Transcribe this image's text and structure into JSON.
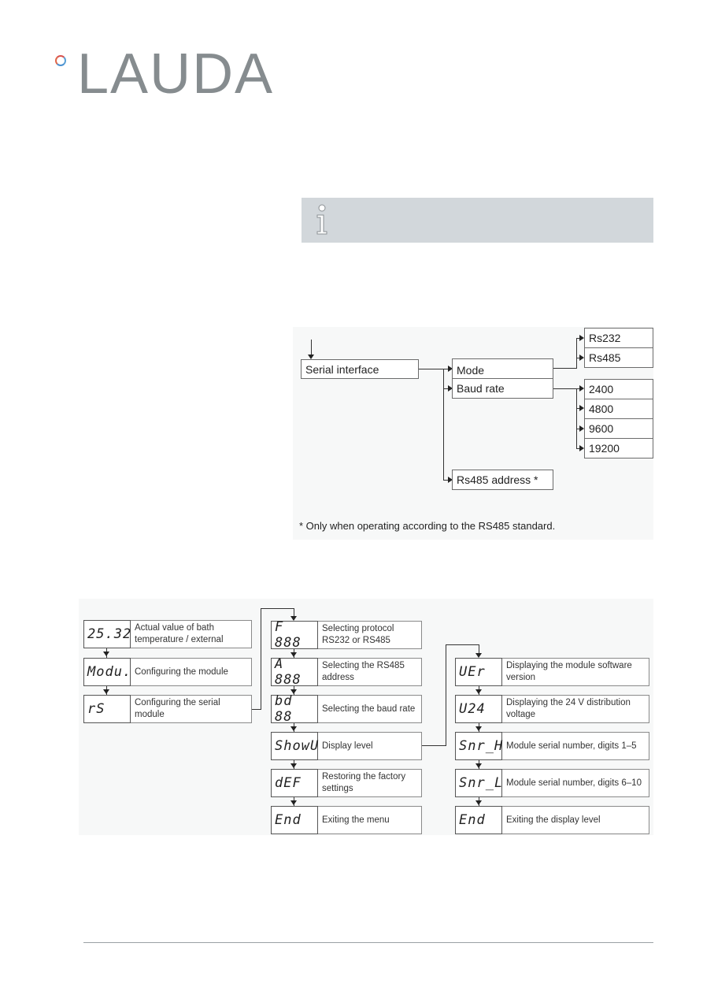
{
  "brand": {
    "logo_text": "LAUDA",
    "ring_colors": {
      "warm": "#d9534f",
      "cool": "#4a90d0"
    },
    "text_color": "#868c8f"
  },
  "info_box": {
    "icon": "info-icon",
    "background": "#d2d7db"
  },
  "serial_diagram": {
    "root": "Serial interface",
    "menu": [
      "Mode",
      "Baud rate"
    ],
    "mode_options": [
      "Rs232",
      "Rs485"
    ],
    "baud_options": [
      "2400",
      "4800",
      "9600",
      "19200"
    ],
    "address": "Rs485 address *",
    "footnote": "* Only when operating according to the RS485 standard."
  },
  "menu_diagram": {
    "column1": [
      {
        "display": "25.32",
        "label": "Actual value of bath temperature / external"
      },
      {
        "display": "Modu.",
        "label": "Configuring the module"
      },
      {
        "display": "rS",
        "label": "Configuring the serial module"
      }
    ],
    "column2": [
      {
        "display": "F 888",
        "label": "Selecting protocol RS232 or RS485"
      },
      {
        "display": "A 888",
        "label": "Selecting the RS485 address"
      },
      {
        "display": "bd 88",
        "label": "Selecting the baud rate"
      },
      {
        "display": "ShowU",
        "label": "Display level"
      },
      {
        "display": "dEF",
        "label": "Restoring the factory settings"
      },
      {
        "display": "End",
        "label": "Exiting the menu"
      }
    ],
    "column3": [
      {
        "display": "UEr",
        "label": "Displaying the module software version"
      },
      {
        "display": "U24",
        "label": "Displaying the 24 V distribution voltage"
      },
      {
        "display": "Snr_H",
        "label": "Module serial number, digits 1–5"
      },
      {
        "display": "Snr_L",
        "label": "Module serial number, digits 6–10"
      },
      {
        "display": "End",
        "label": "Exiting the display level"
      }
    ]
  }
}
